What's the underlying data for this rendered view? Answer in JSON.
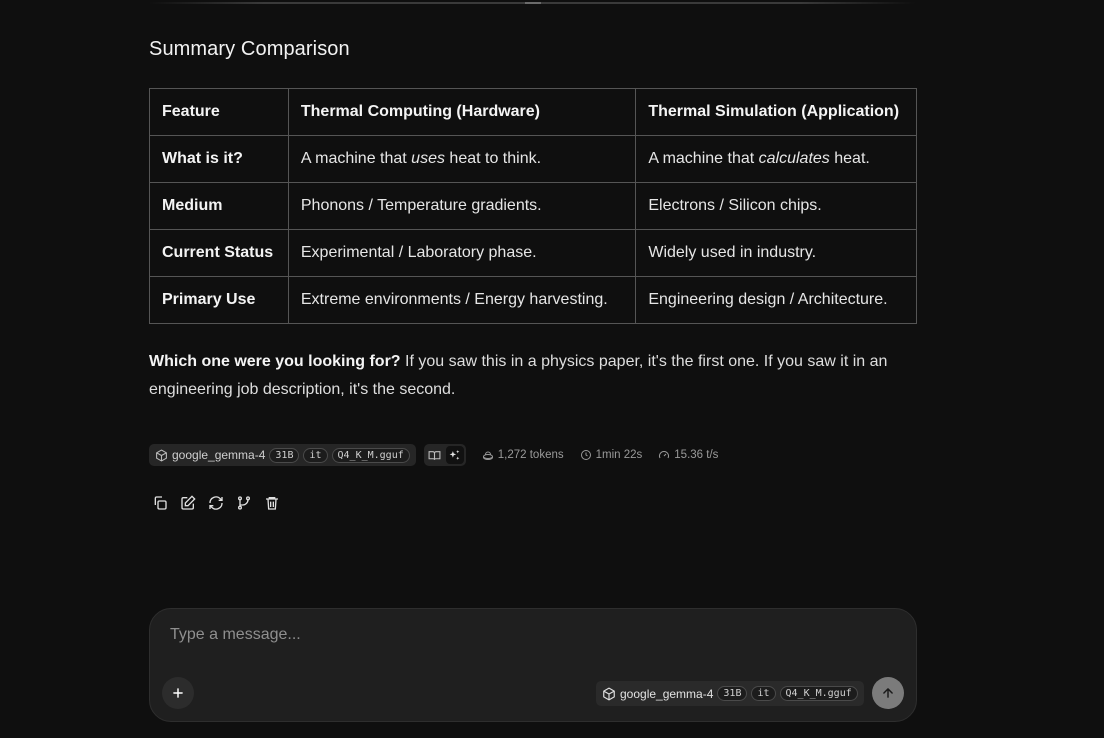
{
  "section_title": "Summary Comparison",
  "table": {
    "headers": [
      "Feature",
      "Thermal Computing (Hardware)",
      "Thermal Simulation (Application)"
    ],
    "rows": [
      {
        "feature": "What is it?",
        "hw_pre": "A machine that ",
        "hw_em": "uses",
        "hw_post": " heat to think.",
        "sim_pre": "A machine that ",
        "sim_em": "calculates",
        "sim_post": " heat."
      },
      {
        "feature": "Medium",
        "hw": "Phonons / Temperature gradients.",
        "sim": "Electrons / Silicon chips."
      },
      {
        "feature": "Current Status",
        "hw": "Experimental / Laboratory phase.",
        "sim": "Widely used in industry."
      },
      {
        "feature": "Primary Use",
        "hw": "Extreme environments / Energy harvesting.",
        "sim": "Engineering design / Architecture."
      }
    ]
  },
  "answer": {
    "bold": "Which one were you looking for?",
    "text": " If you saw this in a physics paper, it's the first one. If you saw it in an engineering job description, it's the second."
  },
  "meta": {
    "model_name": "google_gemma-4",
    "tags": [
      "31B",
      "it",
      "Q4_K_M.gguf"
    ],
    "tokens": "1,272 tokens",
    "duration": "1min 22s",
    "speed": "15.36 t/s"
  },
  "actions": [
    "copy-icon",
    "edit-icon",
    "regenerate-icon",
    "branch-icon",
    "delete-icon"
  ],
  "composer": {
    "placeholder": "Type a message...",
    "model_name": "google_gemma-4",
    "tags": [
      "31B",
      "it",
      "Q4_K_M.gguf"
    ]
  }
}
